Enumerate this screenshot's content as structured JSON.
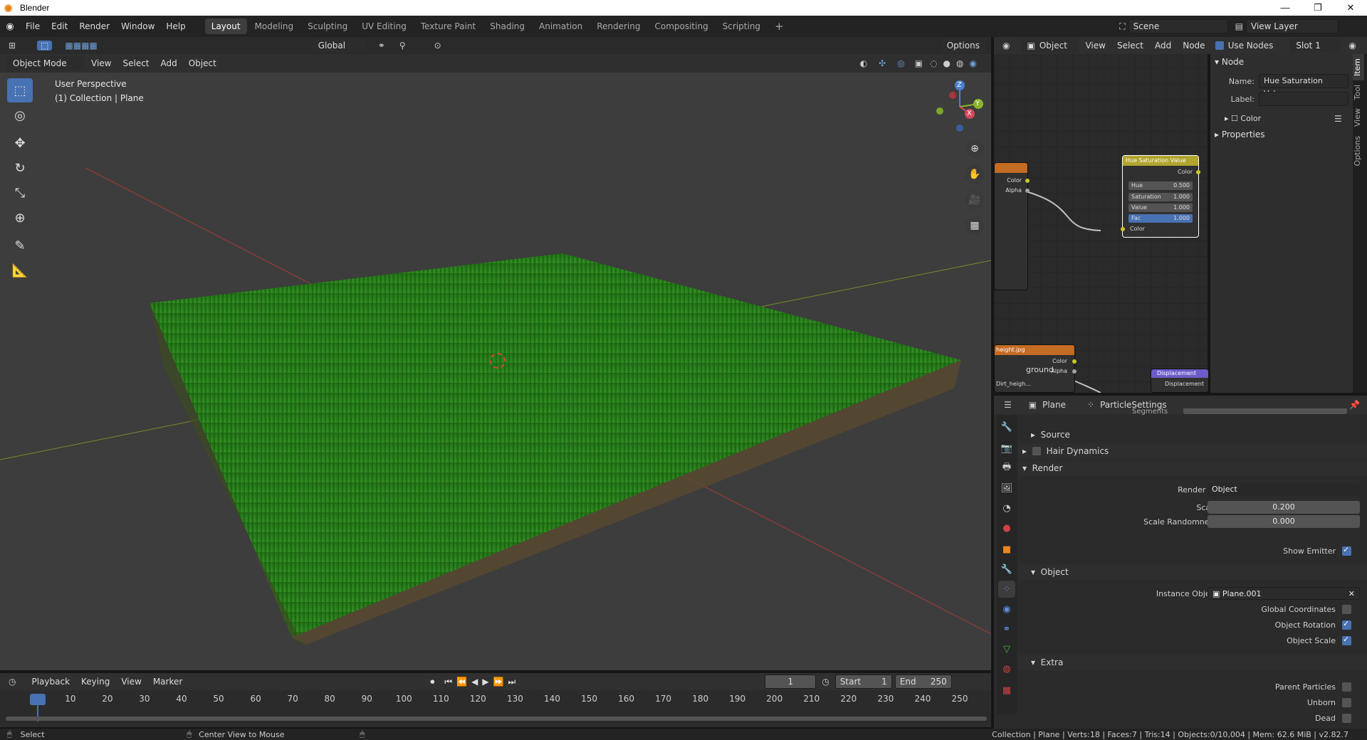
{
  "window": {
    "title": "Blender",
    "controls": [
      "—",
      "❐",
      "✕"
    ]
  },
  "menu": [
    "File",
    "Edit",
    "Render",
    "Window",
    "Help"
  ],
  "workspaces": [
    "Layout",
    "Modeling",
    "Sculpting",
    "UV Editing",
    "Texture Paint",
    "Shading",
    "Animation",
    "Rendering",
    "Compositing",
    "Scripting"
  ],
  "workspace_add": "+",
  "scene": {
    "label": "Scene",
    "view_layer": "View Layer"
  },
  "viewport": {
    "mode": "Object Mode",
    "menus": [
      "View",
      "Select",
      "Add",
      "Object"
    ],
    "orientation": "Global",
    "options": "Options",
    "perspective": "User Perspective",
    "collection": "(1) Collection | Plane",
    "gizmo": {
      "z": "Z",
      "y": "Y",
      "x": "X"
    }
  },
  "node_editor": {
    "editor_type": "Object",
    "menus": [
      "View",
      "Select",
      "Add",
      "Node"
    ],
    "use_nodes": "Use Nodes",
    "slot": "Slot 1",
    "hue_node": {
      "title": "Hue Saturation Value",
      "output": "Color",
      "fields": [
        {
          "label": "Hue",
          "value": "0.500"
        },
        {
          "label": "Saturation",
          "value": "1.000"
        },
        {
          "label": "Value",
          "value": "1.000"
        },
        {
          "label": "Fac",
          "value": "1.000"
        }
      ],
      "input": "Color"
    },
    "tex_node_top": {
      "out1": "Color",
      "out2": "Alpha"
    },
    "tex_node_bottom": {
      "title": "height.jpg",
      "name": "ground",
      "out1": "Color",
      "out2": "Alpha",
      "file": "Dirt_heigh..."
    },
    "disp_node": {
      "title": "Displacement",
      "output": "Displacement"
    }
  },
  "npanel": {
    "header": "Node",
    "name_label": "Name:",
    "name_value": "Hue Saturation Value",
    "label_label": "Label:",
    "color": "Color",
    "properties": "Properties",
    "tabs": [
      "Item",
      "Tool",
      "View",
      "Options"
    ]
  },
  "properties": {
    "object": "Plane",
    "settings": "ParticleSettings",
    "cut_label": "Segments",
    "sections": {
      "source": "Source",
      "hair_dynamics": "Hair Dynamics",
      "render": "Render",
      "object": "Object",
      "extra": "Extra"
    },
    "render_as": {
      "label": "Render As",
      "value": "Object"
    },
    "scale": {
      "label": "Scale",
      "value": "0.200"
    },
    "scale_random": {
      "label": "Scale Randomness",
      "value": "0.000"
    },
    "show_emitter": {
      "label": "Show Emitter",
      "checked": true
    },
    "instance_object": {
      "label": "Instance Object",
      "value": "Plane.001"
    },
    "global_coords": {
      "label": "Global Coordinates",
      "checked": false
    },
    "object_rotation": {
      "label": "Object Rotation",
      "checked": true
    },
    "object_scale": {
      "label": "Object Scale",
      "checked": true
    },
    "parent_particles": {
      "label": "Parent Particles",
      "checked": false
    },
    "unborn": {
      "label": "Unborn",
      "checked": false
    },
    "dead": {
      "label": "Dead",
      "checked": false
    }
  },
  "timeline": {
    "menus": [
      "Playback",
      "Keying",
      "View",
      "Marker"
    ],
    "current_frame": "1",
    "start_label": "Start",
    "start": "1",
    "end_label": "End",
    "end": "250",
    "ticks": [
      "1",
      "10",
      "20",
      "30",
      "40",
      "50",
      "60",
      "70",
      "80",
      "90",
      "100",
      "110",
      "120",
      "130",
      "140",
      "150",
      "160",
      "170",
      "180",
      "190",
      "200",
      "210",
      "220",
      "230",
      "240",
      "250"
    ]
  },
  "status": {
    "left": "Select",
    "middle": "Center View to Mouse",
    "right": "Collection | Plane | Verts:18 | Faces:7 | Tris:14 | Objects:0/10,004 | Mem: 62.6 MiB | v2.82.7"
  },
  "colors": {
    "accent": "#4772b3",
    "grass": "#2a7a1a",
    "node_hue": "#b2a52e",
    "node_tex": "#c46b24",
    "node_disp": "#6b5cc7"
  }
}
